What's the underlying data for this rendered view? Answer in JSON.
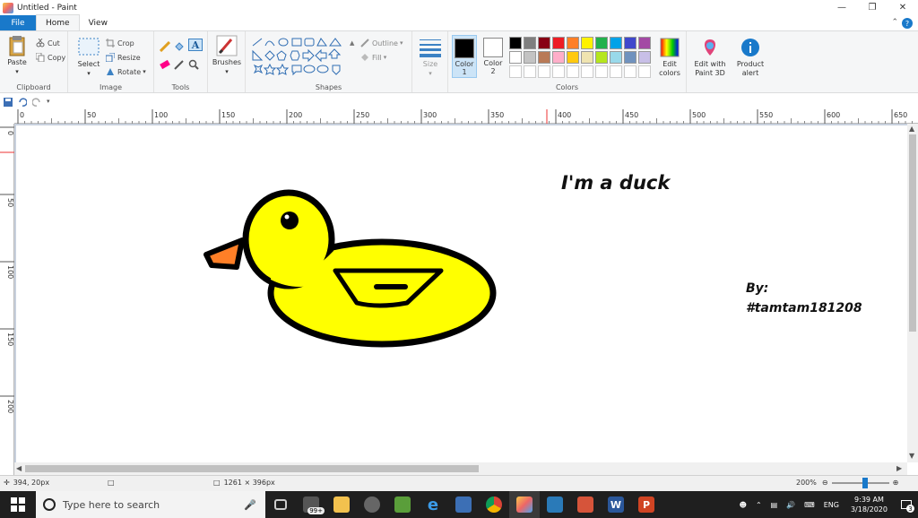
{
  "window": {
    "title": "Untitled - Paint"
  },
  "tabs": [
    {
      "label": "File"
    },
    {
      "label": "Home"
    },
    {
      "label": "View"
    }
  ],
  "ribbon": {
    "clipboard": {
      "label": "Clipboard",
      "paste": "Paste",
      "cut": "Cut",
      "copy": "Copy"
    },
    "image": {
      "label": "Image",
      "select": "Select",
      "crop": "Crop",
      "resize": "Resize",
      "rotate": "Rotate"
    },
    "tools": {
      "label": "Tools"
    },
    "brushes": {
      "label": "Brushes"
    },
    "shapes": {
      "label": "Shapes",
      "outline": "Outline",
      "fill": "Fill"
    },
    "size": {
      "label": "Size"
    },
    "colors": {
      "label": "Colors",
      "color1": "Color 1",
      "color2": "Color 2",
      "edit": "Edit colors",
      "edit_paint3d": "Edit with Paint 3D",
      "product_alert": "Product alert",
      "palette_row1": [
        "#000000",
        "#7f7f7f",
        "#880015",
        "#ed1c24",
        "#ff7f27",
        "#fff200",
        "#22b14c",
        "#00a2e8",
        "#3f48cc",
        "#a349a4"
      ],
      "palette_row2": [
        "#ffffff",
        "#c3c3c3",
        "#b97a57",
        "#ffaec9",
        "#ffc90e",
        "#efe4b0",
        "#b5e61d",
        "#99d9ea",
        "#7092be",
        "#c8bfe7"
      ],
      "color1_value": "#000000",
      "color2_value": "#ffffff"
    }
  },
  "rulers": {
    "h_ticks": [
      "0",
      "50",
      "100",
      "150",
      "200",
      "250",
      "300",
      "350",
      "400",
      "450",
      "500",
      "550",
      "600",
      "650"
    ],
    "v_ticks": [
      "0",
      "50",
      "100",
      "150",
      "200"
    ]
  },
  "canvas": {
    "title_text": "I'm a duck",
    "by_text": "By:",
    "author_text": "#tamtam181208",
    "duck_body_color": "#ffff00",
    "duck_beak_color": "#ff7f27",
    "outline_color": "#000000"
  },
  "status": {
    "cursor_pos": "394, 20px",
    "image_size": "1261 × 396px",
    "zoom": "200%"
  },
  "taskbar": {
    "search_placeholder": "Type here to search",
    "badge": "99+",
    "lang": "ENG",
    "time": "9:39 AM",
    "date": "3/18/2020",
    "notif": "3"
  }
}
